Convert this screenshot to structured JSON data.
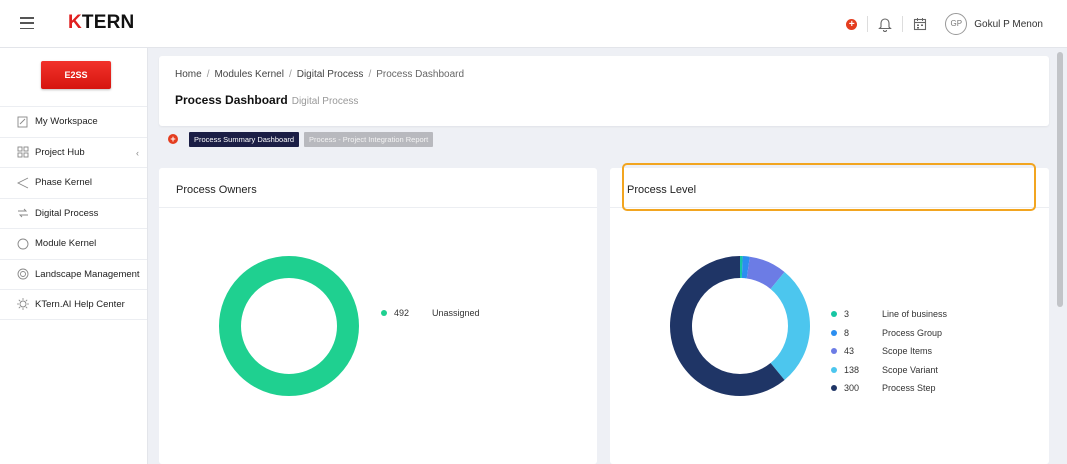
{
  "app": {
    "logo_k": "K",
    "logo_rest": "TERN"
  },
  "user": {
    "initials": "GP",
    "name": "Gokul P Menon"
  },
  "sidebar": {
    "brand_label": "E2SS",
    "items": [
      {
        "label": "My Workspace",
        "icon": "workspace-icon"
      },
      {
        "label": "Project Hub",
        "icon": "grid-icon",
        "has_chevron": true
      },
      {
        "label": "Phase Kernel",
        "icon": "phase-icon"
      },
      {
        "label": "Digital Process",
        "icon": "process-icon"
      },
      {
        "label": "Module Kernel",
        "icon": "module-icon"
      },
      {
        "label": "Landscape Management",
        "icon": "landscape-icon"
      },
      {
        "label": "KTern.AI Help Center",
        "icon": "help-icon"
      }
    ]
  },
  "breadcrumb": {
    "items": [
      "Home",
      "Modules Kernel",
      "Digital Process",
      "Process Dashboard"
    ]
  },
  "page": {
    "title": "Process Dashboard",
    "subtitle": "Digital Process"
  },
  "tabs": [
    {
      "label": "Process Summary Dashboard",
      "active": true
    },
    {
      "label": "Process - Project Integration Report",
      "active": false
    }
  ],
  "panels": {
    "process_owners": {
      "title": "Process Owners"
    },
    "process_level": {
      "title": "Process Level"
    }
  },
  "chart_data": [
    {
      "type": "pie",
      "title": "Process Owners",
      "categories": [
        "Unassigned"
      ],
      "values": [
        492
      ],
      "colors": [
        "#1fd090"
      ]
    },
    {
      "type": "pie",
      "title": "Process Level",
      "categories": [
        "Line of business",
        "Process Group",
        "Scope Items",
        "Scope Variant",
        "Process Step"
      ],
      "values": [
        3,
        8,
        43,
        138,
        300
      ],
      "colors": [
        "#17c6a3",
        "#2b8ef0",
        "#6c7ce5",
        "#4cc6ee",
        "#1f3566"
      ]
    }
  ]
}
